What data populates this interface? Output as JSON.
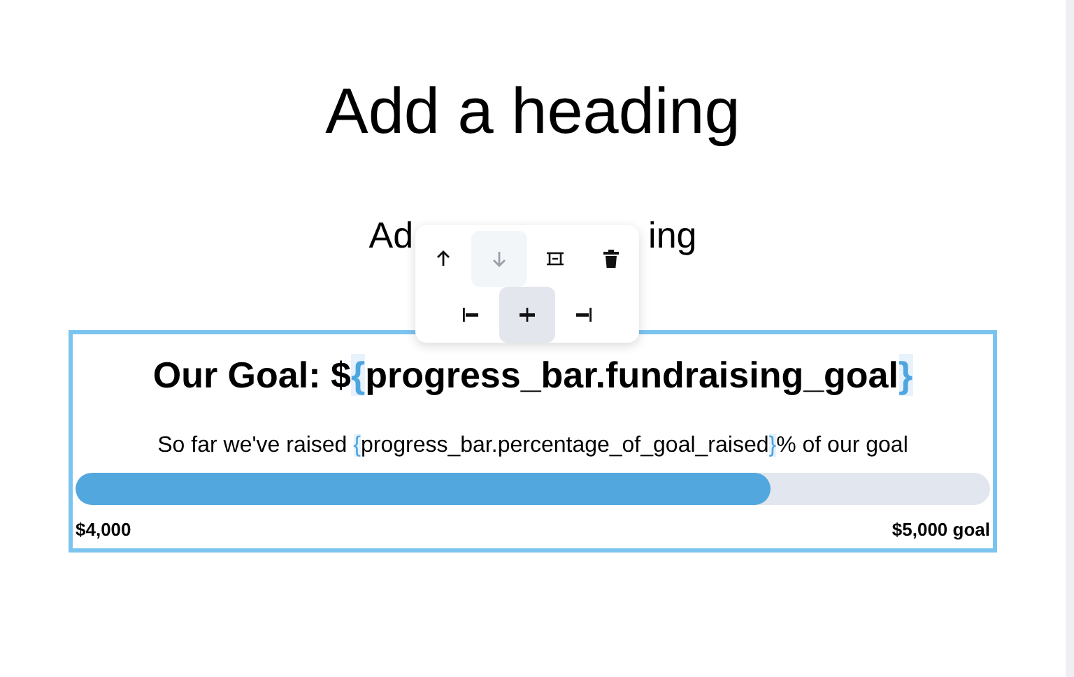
{
  "heading": "Add a heading",
  "subheading": {
    "before": "Ad",
    "after": "ing"
  },
  "toolbar": {
    "rows": [
      [
        {
          "kind": "move-up",
          "disabled": false,
          "selected": false
        },
        {
          "kind": "move-down",
          "disabled": true,
          "selected": false
        },
        {
          "kind": "spacing",
          "disabled": false,
          "selected": false
        },
        {
          "kind": "delete",
          "disabled": false,
          "selected": false
        }
      ],
      [
        {
          "kind": "align-left",
          "disabled": false,
          "selected": false
        },
        {
          "kind": "align-center",
          "disabled": false,
          "selected": true
        },
        {
          "kind": "align-right",
          "disabled": false,
          "selected": false
        }
      ]
    ]
  },
  "block": {
    "selected": true,
    "title": [
      {
        "kind": "text",
        "text": "Our Goal: $"
      },
      {
        "kind": "variable",
        "open": "{",
        "name": "progress_bar.fundraising_goal",
        "close": "}"
      }
    ],
    "subtitle": [
      {
        "kind": "text",
        "text": "So far we've raised "
      },
      {
        "kind": "variable",
        "open": "{",
        "name": "progress_bar.percentage_of_goal_raised",
        "close": "}"
      },
      {
        "kind": "text",
        "text": "% of our goal"
      }
    ],
    "progress": {
      "level": 0.76
    },
    "start_label": "$4,000",
    "end_label": "$5,000 goal"
  }
}
